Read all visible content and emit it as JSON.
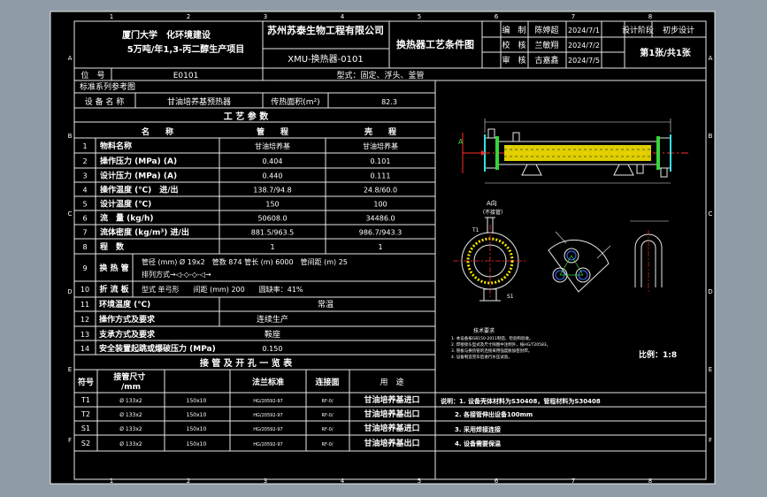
{
  "colors": {
    "window_bg": "#8f9ca7",
    "paper": "#000000",
    "line_white": "#e8e8e8",
    "text_white": "#ffffff",
    "accent_red": "#ff2d2d",
    "accent_yellow": "#f7e400",
    "accent_green": "#37d43a",
    "accent_cyan": "#36e0e0",
    "accent_blue": "#3c6cff",
    "accent_magenta": "#e040e0"
  },
  "frame": {
    "col_marks": [
      "1",
      "2",
      "3",
      "4",
      "5",
      "6",
      "7",
      "8"
    ],
    "row_marks": [
      "A",
      "B",
      "C",
      "D",
      "E",
      "F"
    ]
  },
  "title_block": {
    "client": "厦门大学　化环境建设",
    "project": "5万吨/年1,3-丙二醇生产项目",
    "company": "苏州苏泰生物工程有限公司",
    "drawing_no": "XMU-换热器-0101",
    "drawing_title": "换热器工艺条件图",
    "sign_rows": [
      {
        "role": "编　制",
        "name": "陈婷超",
        "date": "2024/7/1"
      },
      {
        "role": "校　核",
        "name": "兰敏翔",
        "date": "2024/7/2"
      },
      {
        "role": "审　核",
        "name": "古嘉鑫",
        "date": "2024/7/5"
      }
    ],
    "stage_label": "设计阶段",
    "stage_value": "初步设计",
    "sheet": "第1张/共1张"
  },
  "info": {
    "tag_label": "位　号",
    "tag_value": "E0101",
    "type_text": "型式：固定、浮头、釜管",
    "std_label": "标准系列参考图",
    "name_label": "设 备 名 称",
    "name_value": "甘油培养基预热器",
    "area_label": "传热面积(m²)",
    "area_value": "82.3"
  },
  "process": {
    "section_title": "工 艺 参 数",
    "header": {
      "item": "名　　称",
      "tube": "管　　程",
      "shell": "壳　　程"
    },
    "rows": [
      {
        "no": "1",
        "name": "物料名称",
        "tube": "甘油培养基",
        "shell": "甘油培养基"
      },
      {
        "no": "2",
        "name": "操作压力 (MPa) (A)",
        "tube": "0.404",
        "shell": "0.101"
      },
      {
        "no": "3",
        "name": "设计压力 (MPa) (A)",
        "tube": "0.440",
        "shell": "0.111"
      },
      {
        "no": "4",
        "name": "操作温度 (℃)　进/出",
        "tube": "138.7/94.8",
        "shell": "24.8/60.0"
      },
      {
        "no": "5",
        "name": "设计温度 (℃)",
        "tube": "150",
        "shell": "100"
      },
      {
        "no": "6",
        "name": "流　量 (kg/h)",
        "tube": "50608.0",
        "shell": "34486.0"
      },
      {
        "no": "7",
        "name": "流体密度 (kg/m³) 进/出",
        "tube": "881.5/963.5",
        "shell": "986.7/943.3"
      },
      {
        "no": "8",
        "name": "程　数",
        "tube": "1",
        "shell": "1"
      }
    ],
    "row9": {
      "no": "9",
      "label": "换 热 管",
      "spec": "管径 (mm) Ø 19x2　管数 874 管长 (m) 6000　管间距 (m) 25",
      "layout": "排列方式→◁-◇-◇-◁→"
    },
    "row10": {
      "no": "10",
      "label": "折 流 板",
      "text": "型式 单弓形　　间距 (mm) 200　　圆缺率：41%"
    },
    "row11": {
      "no": "11",
      "label": "环境温度 (℃)",
      "value": "常温"
    },
    "row12": {
      "no": "12",
      "label": "操作方式及要求",
      "value": "连续生产"
    },
    "row13": {
      "no": "13",
      "label": "支承方式及要求",
      "value": "鞍座"
    },
    "row14": {
      "no": "14",
      "label": "安全装置起跳或爆破压力 (MPa)",
      "value": "0.150"
    }
  },
  "nozzles": {
    "section_title": "接 管 及 开 孔 一 览 表",
    "header": {
      "mark": "符号",
      "size": "接管尺寸\n/mm",
      "flange": "法兰标准",
      "face": "连接面",
      "use": "用　途"
    },
    "rows": [
      {
        "mark": "T1",
        "size": "Ø 133x2",
        "rating": "150x10",
        "std": "HG/20592-97",
        "face": "RF-0/",
        "use": "甘油培养基进口"
      },
      {
        "mark": "T2",
        "size": "Ø 133x2",
        "rating": "150x10",
        "std": "HG/20592-97",
        "face": "RF-0/",
        "use": "甘油培养基出口"
      },
      {
        "mark": "S1",
        "size": "Ø 133x2",
        "rating": "150x10",
        "std": "HG/20592-97",
        "face": "RF-0/",
        "use": "甘油培养基进口"
      },
      {
        "mark": "S2",
        "size": "Ø 133x2",
        "rating": "150x10",
        "std": "HG/20592-97",
        "face": "RF-0/",
        "use": "甘油培养基出口"
      }
    ]
  },
  "remarks": {
    "lines": [
      "说明：1. 设备壳体材料为S30408，管程材料为S30408",
      "2. 各接管伸出设备100mm",
      "3. 采用焊接连接",
      "4. 设备需要保温"
    ]
  },
  "tech_notes": {
    "title": "技术要求",
    "lines": [
      "1. 本设备按GB150-2011制造、检验和验收。",
      "2. 焊接接头型式及尺寸除图中注明外，按HG/T20583。",
      "3. 管板与换热管的连接采用强度胀加密封焊。",
      "4. 设备制造完毕后进行水压试验。"
    ]
  },
  "scale": "比例：1:8",
  "drawing_labels": {
    "view_a": "A",
    "view_a_title": "A向",
    "view_a_sub": "（不接管）",
    "t1": "T1",
    "s1": "S1"
  }
}
